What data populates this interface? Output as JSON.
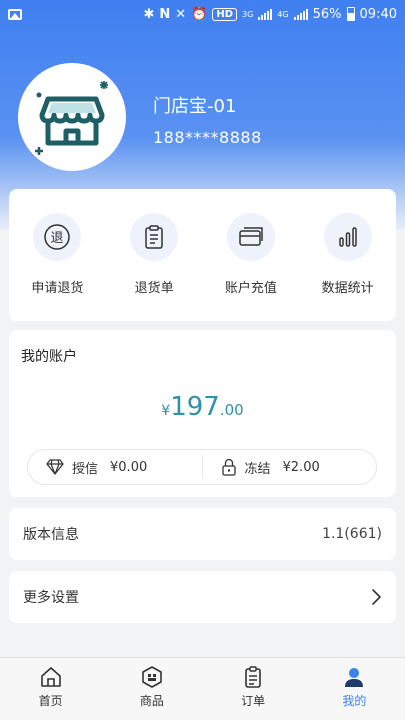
{
  "status_bar": {
    "left_icon": "image-icon",
    "hd_label": "HD",
    "net_3g": "3G",
    "net_4g": "4G",
    "battery_percent": "56%",
    "time": "09:40"
  },
  "profile": {
    "store_name": "门店宝-01",
    "phone": "188****8888",
    "avatar_icon": "store-icon"
  },
  "quick_actions": [
    {
      "label": "申请退货",
      "icon": "return-icon",
      "glyph": "退"
    },
    {
      "label": "退货单",
      "icon": "document-icon"
    },
    {
      "label": "账户充值",
      "icon": "card-icon"
    },
    {
      "label": "数据统计",
      "icon": "bar-chart-icon"
    }
  ],
  "account": {
    "title": "我的账户",
    "currency": "¥",
    "balance_int": "197",
    "balance_dec": ".00",
    "credit_label": "授信",
    "credit_value": "¥0.00",
    "frozen_label": "冻结",
    "frozen_value": "¥2.00"
  },
  "version": {
    "label": "版本信息",
    "value": "1.1(661)"
  },
  "settings": {
    "label": "更多设置"
  },
  "tabs": [
    {
      "label": "首页",
      "icon": "home-icon"
    },
    {
      "label": "商品",
      "icon": "product-icon"
    },
    {
      "label": "订单",
      "icon": "order-icon"
    },
    {
      "label": "我的",
      "icon": "user-icon",
      "active": true
    }
  ],
  "colors": {
    "primary": "#3b82f0",
    "balance": "#2f90a8",
    "icon_teal": "#1e5f66",
    "icon_bg": "#eef2fa"
  }
}
